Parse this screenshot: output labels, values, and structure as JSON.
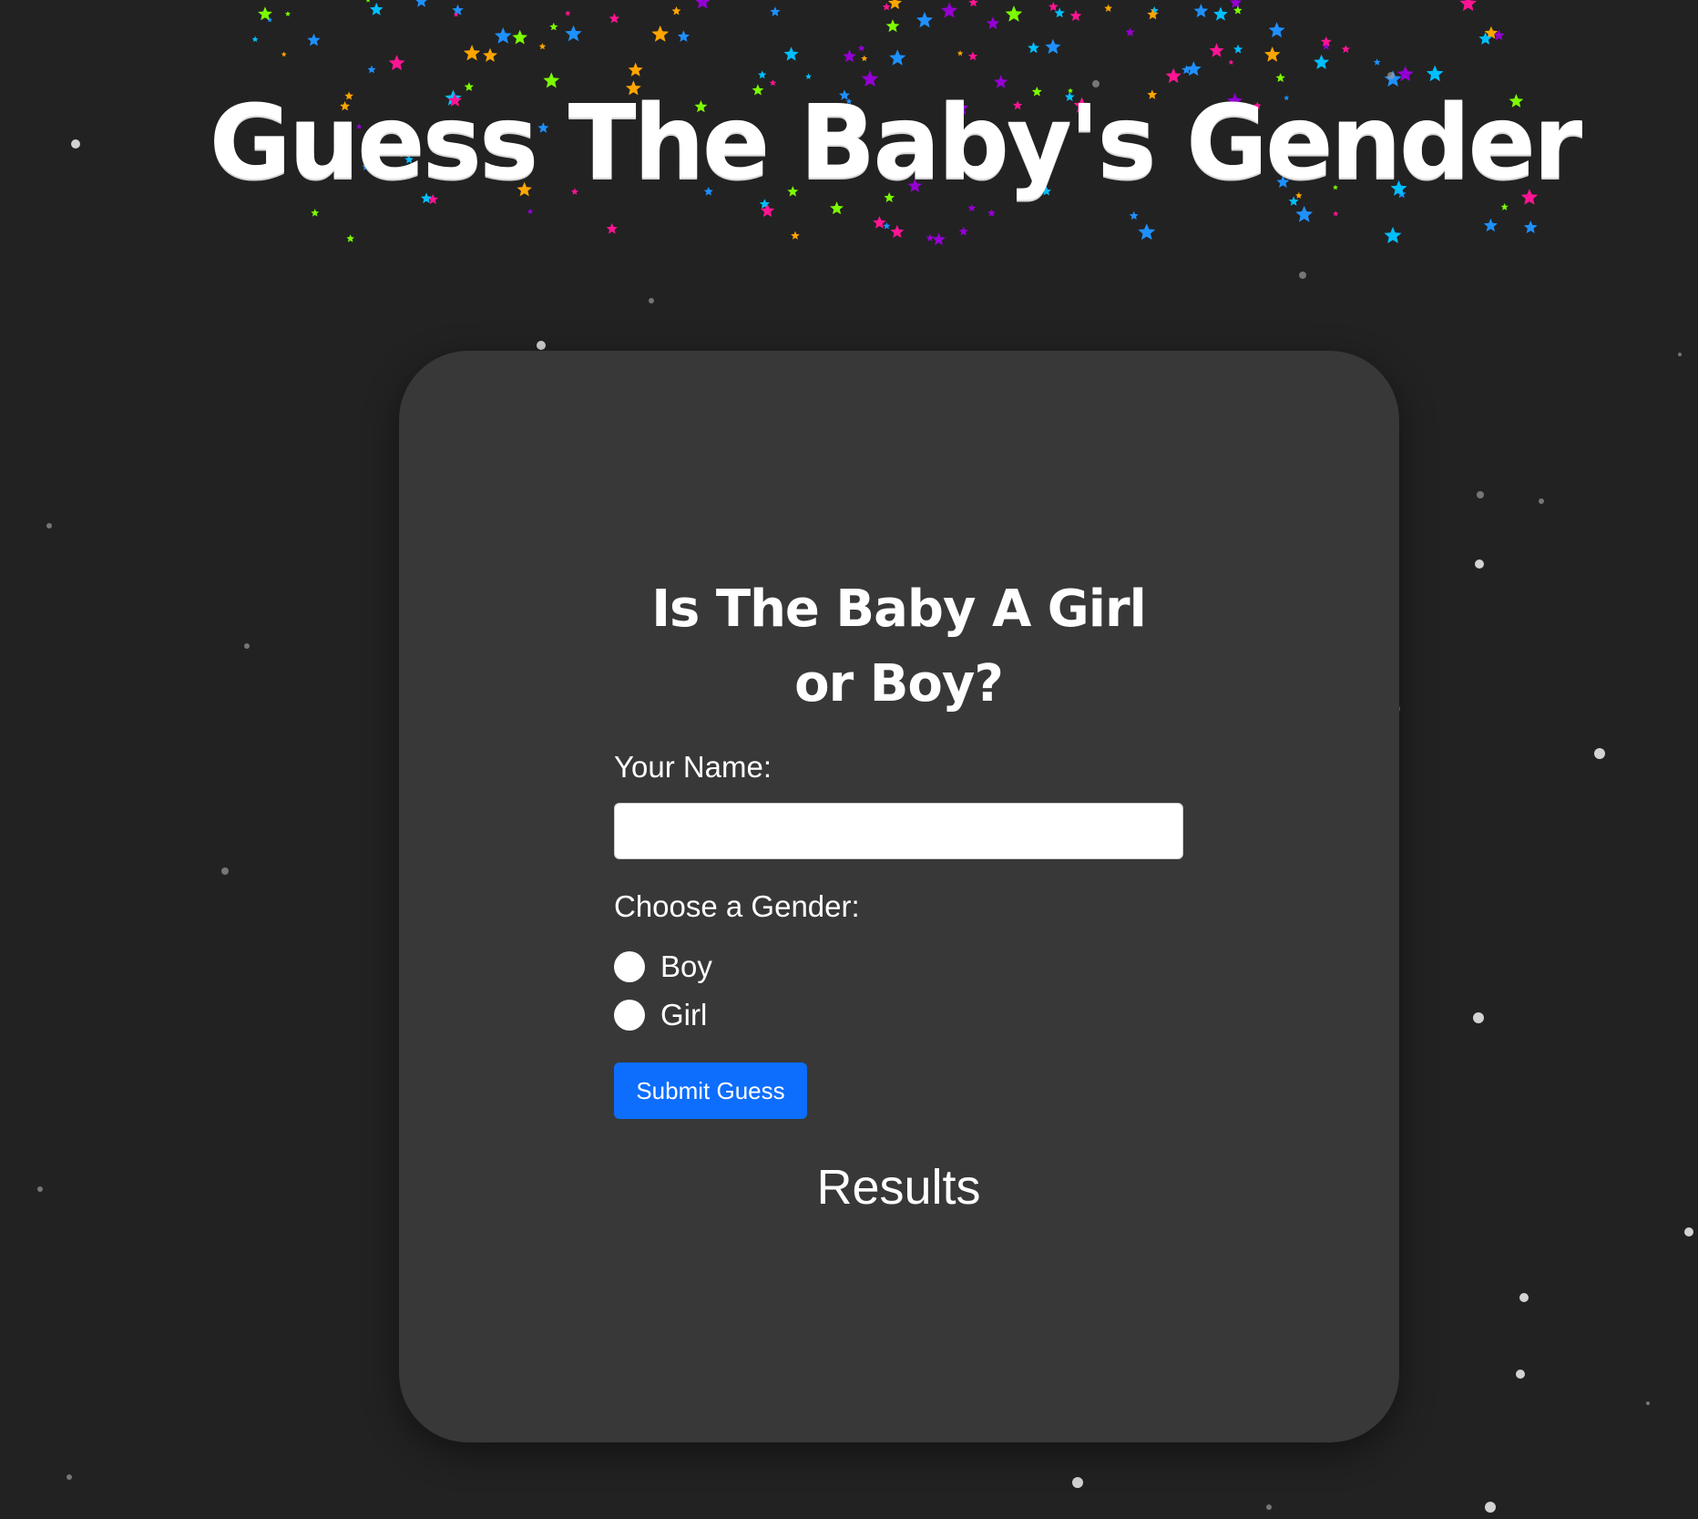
{
  "header": {
    "title": "Guess The Baby's Gender"
  },
  "form": {
    "question": "Is The Baby A Girl or Boy?",
    "name_label": "Your Name:",
    "name_value": "",
    "gender_label": "Choose a Gender:",
    "options": [
      {
        "label": "Boy",
        "checked": false
      },
      {
        "label": "Girl",
        "checked": false
      }
    ],
    "submit_label": "Submit Guess"
  },
  "results": {
    "heading": "Results"
  },
  "colors": {
    "background": "#222222",
    "card": "#383838",
    "button": "#0d6efd",
    "text": "#ffffff",
    "confetti": [
      "#1e90ff",
      "#ff1493",
      "#9400d3",
      "#7cfc00",
      "#ffa500",
      "#00bfff"
    ]
  },
  "icons": {
    "decor": [
      "star-confetti-icon",
      "snow-dot-icon"
    ]
  }
}
